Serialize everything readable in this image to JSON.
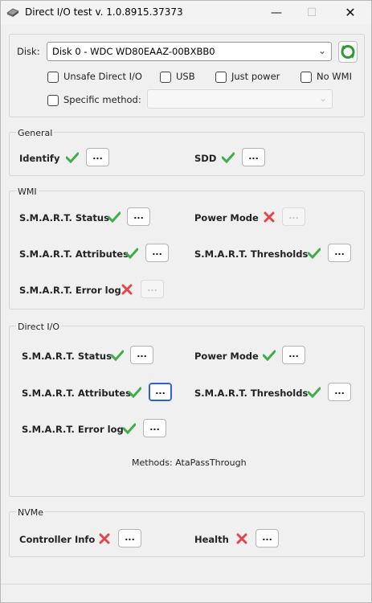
{
  "window": {
    "title": "Direct I/O test v. 1.0.8915.37373",
    "minimize_icon": "minimize-icon",
    "maximize_icon": "maximize-icon",
    "close_icon": "close-icon"
  },
  "disk": {
    "label": "Disk:",
    "selected": "Disk 0 - WDC WD80EAAZ-00BXBB0",
    "refresh_icon": "refresh-icon",
    "options": [
      {
        "label": "Unsafe Direct I/O",
        "checked": false
      },
      {
        "label": "USB",
        "checked": false
      },
      {
        "label": "Just power",
        "checked": false
      },
      {
        "label": "No WMI",
        "checked": false
      }
    ],
    "specific_method": {
      "label": "Specific method:",
      "checked": false,
      "value": ""
    }
  },
  "general": {
    "title": "General",
    "identify": {
      "label": "Identify",
      "status": "ok",
      "button": "..."
    },
    "sdd": {
      "label": "SDD",
      "status": "ok",
      "button": "..."
    }
  },
  "wmi": {
    "title": "WMI",
    "smart_status": {
      "label": "S.M.A.R.T. Status",
      "status": "ok",
      "button": "..."
    },
    "power_mode": {
      "label": "Power Mode",
      "status": "fail",
      "button": "..."
    },
    "smart_attributes": {
      "label": "S.M.A.R.T. Attributes",
      "status": "ok",
      "button": "..."
    },
    "smart_thresholds": {
      "label": "S.M.A.R.T. Thresholds",
      "status": "ok",
      "button": "..."
    },
    "smart_error_log": {
      "label": "S.M.A.R.T. Error log",
      "status": "fail",
      "button": "..."
    }
  },
  "direct_io": {
    "title": "Direct I/O",
    "smart_status": {
      "label": "S.M.A.R.T. Status",
      "status": "ok",
      "button": "..."
    },
    "power_mode": {
      "label": "Power Mode",
      "status": "ok",
      "button": "..."
    },
    "smart_attributes": {
      "label": "S.M.A.R.T. Attributes",
      "status": "ok",
      "button": "..."
    },
    "smart_thresholds": {
      "label": "S.M.A.R.T. Thresholds",
      "status": "ok",
      "button": "..."
    },
    "smart_error_log": {
      "label": "S.M.A.R.T. Error log",
      "status": "ok",
      "button": "..."
    },
    "methods": "Methods: AtaPassThrough"
  },
  "nvme": {
    "title": "NVMe",
    "controller_info": {
      "label": "Controller Info",
      "status": "fail",
      "button": "..."
    },
    "health": {
      "label": "Health",
      "status": "fail",
      "button": "..."
    }
  },
  "colors": {
    "ok": "#3fae49",
    "fail": "#e0474c",
    "focus": "#2a62d6"
  }
}
